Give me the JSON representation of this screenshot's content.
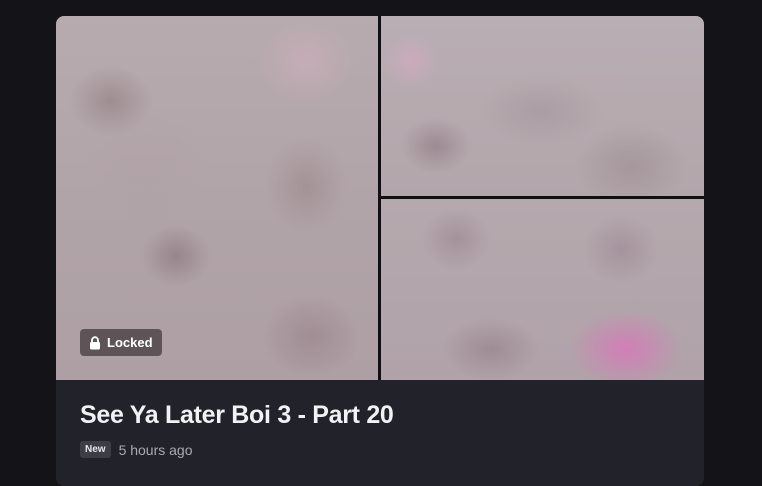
{
  "card": {
    "locked_label": "Locked",
    "title": "See Ya Later Boi 3 - Part 20",
    "new_badge": "New",
    "timestamp": "5 hours ago"
  },
  "icons": {
    "lock": "lock-icon"
  },
  "colors": {
    "page_background": "#141317",
    "card_background": "#22232a",
    "badge_background": "#5e5458",
    "title_text": "#f2f2f4",
    "meta_text": "#a9aab2"
  }
}
